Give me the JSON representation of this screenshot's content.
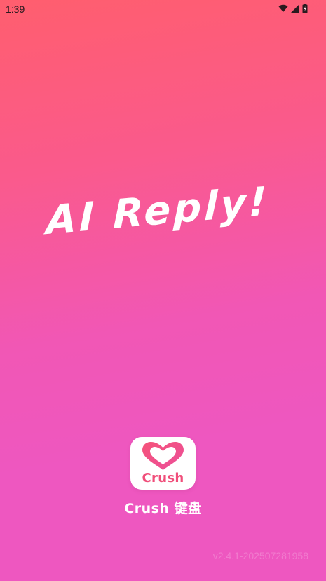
{
  "status_bar": {
    "time": "1:39",
    "icons": [
      "wifi-icon",
      "signal-icon",
      "battery-icon"
    ]
  },
  "splash": {
    "headline": "AI Reply!",
    "logo_text": "Crush",
    "app_name": "Crush 键盘",
    "version": "v2.4.1-202507281958"
  },
  "colors": {
    "gradient_top": "#ff5e6e",
    "gradient_bottom": "#ee57c0",
    "logo_accent": "#f04e7a"
  }
}
